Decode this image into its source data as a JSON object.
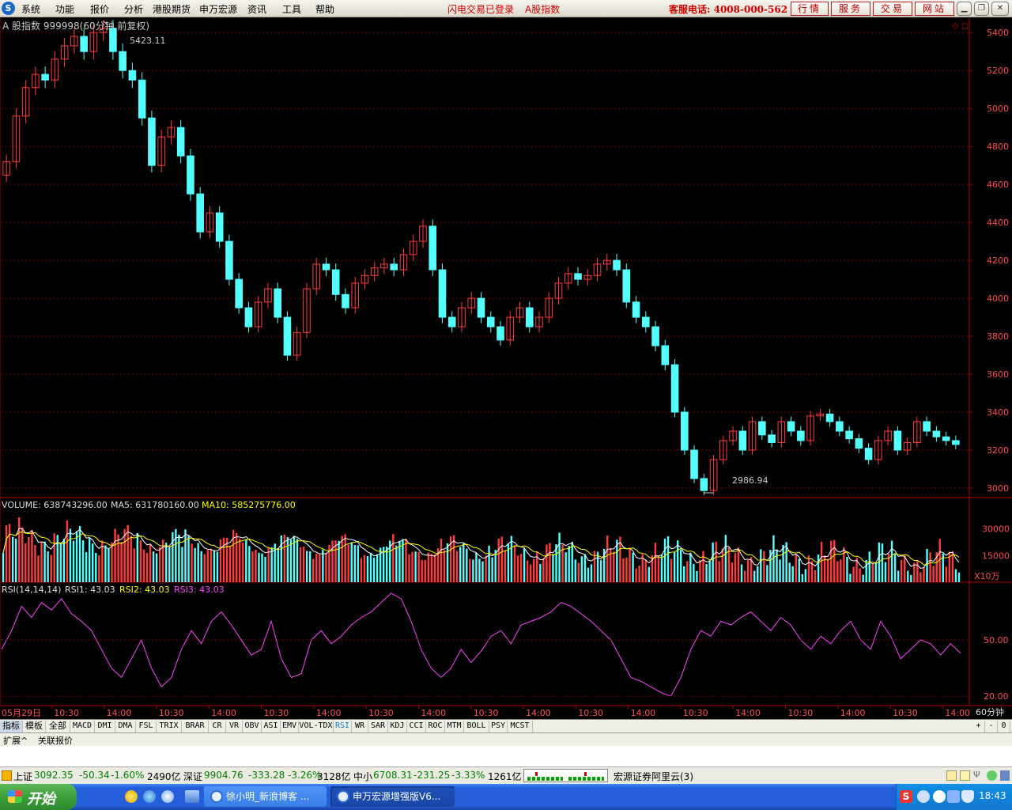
{
  "menu": {
    "items": [
      "系统",
      "功能",
      "报价",
      "分析",
      "港股期货",
      "申万宏源",
      "资讯",
      "工具",
      "帮助"
    ],
    "login_status": "闪电交易已登录",
    "security_tag": "A股指数",
    "hotline": "客服电话: 4008-000-562",
    "quick_buttons": [
      "行情",
      "服务",
      "交易",
      "网站"
    ]
  },
  "chart_header": {
    "title": "A 股指数  999998(60分钟,前复权)",
    "high_label": "5423.11",
    "low_label": "2986.94"
  },
  "volume_header": {
    "volume": "VOLUME: 638743296.00",
    "ma5": "MA5: 631780160.00",
    "ma10": "MA10: 585275776.00",
    "unit": "X10万"
  },
  "rsi_header": {
    "name": "RSI(14,14,14)",
    "rsi1": "RSI1: 43.03",
    "rsi2": "RSI2: 43.03",
    "rsi3": "RSI3: 43.03"
  },
  "price_axis": [
    "5400",
    "5200",
    "5000",
    "4800",
    "4600",
    "4400",
    "4200",
    "4000",
    "3800",
    "3600",
    "3400",
    "3200",
    "3000"
  ],
  "volume_axis": [
    "30000",
    "15000"
  ],
  "rsi_axis": [
    "50.00",
    "20.00"
  ],
  "time_axis": [
    "05月29日",
    "10:30",
    "14:00",
    "10:30",
    "14:00",
    "10:30",
    "14:00",
    "10:30",
    "14:00",
    "10:30",
    "14:00",
    "10:30",
    "14:00",
    "10:30",
    "14:00",
    "10:30",
    "14:00",
    "10:30",
    "14:00"
  ],
  "period": "60分钟",
  "tabs": [
    "指标",
    "模板",
    "全部",
    "MACD",
    "DMI",
    "DMA",
    "FSL",
    "TRIX",
    "BRAR",
    "CR",
    "VR",
    "OBV",
    "ASI",
    "EMV",
    "VOL-TDX",
    "RSI",
    "WR",
    "SAR",
    "KDJ",
    "CCI",
    "ROC",
    "MTM",
    "BOLL",
    "PSY",
    "MCST"
  ],
  "tab_controls": [
    "+",
    "-",
    "0"
  ],
  "sub_tabs": [
    "扩展^",
    "关联报价"
  ],
  "status_bar": {
    "sh_label": "上证",
    "sh_value": "3092.35",
    "sh_change": "-50.34",
    "sh_pct": "-1.60%",
    "sh_amount": "2490亿",
    "sz_label": "深证",
    "sz_value": "9904.76",
    "sz_change": "-333.28",
    "sz_pct": "-3.26%",
    "sz_amount": "3128亿",
    "zx_label": "中小",
    "zx_value": "6708.31",
    "zx_change": "-231.25",
    "zx_pct": "-3.33%",
    "zx_amount": "1261亿",
    "server": "宏源证券阿里云(3)"
  },
  "taskbar": {
    "start": "开始",
    "tasks": [
      "徐小明_新浪博客 ...",
      "申万宏源增强版V6..."
    ],
    "clock": "18:43"
  },
  "chart_data": {
    "type": "candlestick",
    "period": "60分钟",
    "price_range": [
      2950,
      5480
    ],
    "closes": [
      4720,
      4960,
      5110,
      5180,
      5150,
      5260,
      5330,
      5380,
      5300,
      5400,
      5423.11,
      5300,
      5200,
      5150,
      4950,
      4700,
      4850,
      4900,
      4750,
      4550,
      4350,
      4450,
      4300,
      4100,
      3950,
      3850,
      3980,
      4050,
      3900,
      3700,
      3820,
      4050,
      4180,
      4150,
      4020,
      3950,
      4080,
      4120,
      4160,
      4180,
      4150,
      4230,
      4300,
      4380,
      4150,
      3900,
      3850,
      3950,
      4000,
      3900,
      3850,
      3780,
      3900,
      3950,
      3850,
      3900,
      4000,
      4080,
      4130,
      4100,
      4120,
      4180,
      4200,
      4150,
      3980,
      3900,
      3850,
      3750,
      3650,
      3400,
      3200,
      3050,
      2986.94,
      3150,
      3250,
      3300,
      3200,
      3350,
      3280,
      3240,
      3350,
      3300,
      3250,
      3380,
      3390,
      3350,
      3300,
      3260,
      3210,
      3150,
      3250,
      3300,
      3200,
      3240,
      3350,
      3300,
      3270,
      3250,
      3230
    ],
    "volume_range": [
      0,
      45000
    ],
    "rsi_values": [
      45,
      55,
      68,
      62,
      70,
      66,
      72,
      64,
      60,
      55,
      45,
      35,
      30,
      40,
      50,
      35,
      25,
      30,
      45,
      55,
      48,
      60,
      65,
      58,
      50,
      42,
      45,
      60,
      40,
      30,
      32,
      50,
      55,
      48,
      52,
      58,
      62,
      65,
      70,
      75,
      72,
      60,
      45,
      35,
      30,
      35,
      45,
      38,
      44,
      52,
      55,
      48,
      58,
      60,
      62,
      65,
      70,
      68,
      64,
      60,
      55,
      50,
      40,
      30,
      28,
      25,
      22,
      20,
      30,
      45,
      55,
      52,
      60,
      58,
      62,
      65,
      60,
      55,
      62,
      58,
      50,
      45,
      52,
      48,
      55,
      60,
      50,
      45,
      60,
      52,
      40,
      45,
      50,
      48,
      42,
      48,
      43.03
    ],
    "rsi_range": [
      15,
      80
    ]
  }
}
